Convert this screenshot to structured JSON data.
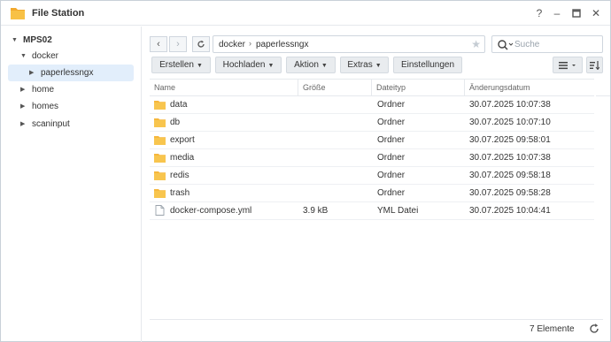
{
  "window": {
    "title": "File Station",
    "controls": [
      "?",
      "–",
      "□",
      "✕"
    ]
  },
  "sidebar": {
    "root": "MPS02",
    "items": [
      {
        "label": "docker",
        "expanded": true
      },
      {
        "label": "paperlessngx",
        "selected": true
      },
      {
        "label": "home"
      },
      {
        "label": "homes"
      },
      {
        "label": "scaninput"
      }
    ]
  },
  "toolbar": {
    "back": "‹",
    "forward": "›",
    "refresh_icon": "refresh-icon",
    "breadcrumb": [
      "docker",
      "paperlessngx"
    ],
    "search_placeholder": "Suche",
    "buttons": [
      {
        "label": "Erstellen",
        "dropdown": true
      },
      {
        "label": "Hochladen",
        "dropdown": true
      },
      {
        "label": "Aktion",
        "dropdown": true
      },
      {
        "label": "Extras",
        "dropdown": true
      },
      {
        "label": "Einstellungen",
        "dropdown": false
      }
    ]
  },
  "table": {
    "columns": [
      "Name",
      "Größe",
      "Dateityp",
      "Änderungsdatum"
    ],
    "rows": [
      {
        "icon": "folder-icon",
        "name": "data",
        "size": "",
        "type": "Ordner",
        "modified": "30.07.2025 10:07:38"
      },
      {
        "icon": "folder-icon",
        "name": "db",
        "size": "",
        "type": "Ordner",
        "modified": "30.07.2025 10:07:10"
      },
      {
        "icon": "folder-icon",
        "name": "export",
        "size": "",
        "type": "Ordner",
        "modified": "30.07.2025 09:58:01"
      },
      {
        "icon": "folder-icon",
        "name": "media",
        "size": "",
        "type": "Ordner",
        "modified": "30.07.2025 10:07:38"
      },
      {
        "icon": "folder-icon",
        "name": "redis",
        "size": "",
        "type": "Ordner",
        "modified": "30.07.2025 09:58:18"
      },
      {
        "icon": "folder-icon",
        "name": "trash",
        "size": "",
        "type": "Ordner",
        "modified": "30.07.2025 09:58:28"
      },
      {
        "icon": "file-icon",
        "name": "docker-compose.yml",
        "size": "3.9 kB",
        "type": "YML Datei",
        "modified": "30.07.2025 10:04:41"
      }
    ]
  },
  "footer": {
    "count": "7 Elemente"
  },
  "colors": {
    "accent": "#2f7fd5",
    "folder": "#f6b73c",
    "selection": "#e2eefb"
  }
}
